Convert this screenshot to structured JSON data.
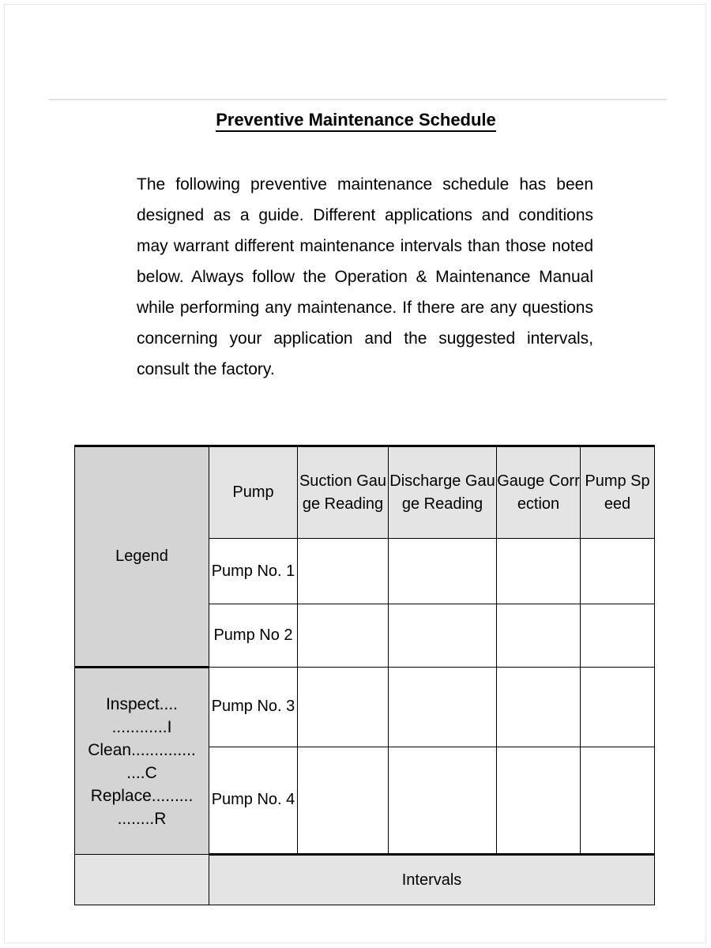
{
  "document": {
    "title": "Preventive Maintenance Schedule",
    "paragraph": "The following preventive maintenance schedule has been designed as a guide. Different applications and conditions may warrant different maintenance intervals than those noted below. Always follow the Operation & Maintenance Manual while performing any maintenance. If there are any questions concerning your application and the suggested intervals, consult the factory."
  },
  "table": {
    "legend": {
      "header": "Legend",
      "lines": [
        "Inspect....",
        "............I",
        "Clean..............",
        "....C",
        "Replace.........",
        "........R"
      ]
    },
    "headers": {
      "pump": "Pump",
      "suction": "Suction Gauge Reading",
      "discharge": "Discharge Gauge Reading",
      "correction": "Gauge Correction",
      "speed": "Pump Speed"
    },
    "rows": [
      {
        "pump": "Pump No. 1",
        "suction": "",
        "discharge": "",
        "correction": "",
        "speed": ""
      },
      {
        "pump": "Pump No 2",
        "suction": "",
        "discharge": "",
        "correction": "",
        "speed": ""
      },
      {
        "pump": "Pump No. 3",
        "suction": "",
        "discharge": "",
        "correction": "",
        "speed": ""
      },
      {
        "pump": "Pump No. 4",
        "suction": "",
        "discharge": "",
        "correction": "",
        "speed": ""
      }
    ],
    "footer": {
      "intervals": "Intervals"
    }
  },
  "colors": {
    "legend_shade": "#d4d4d4",
    "header_shade": "#e4e4e4",
    "border": "#000000",
    "rule": "#e3e3e3"
  }
}
